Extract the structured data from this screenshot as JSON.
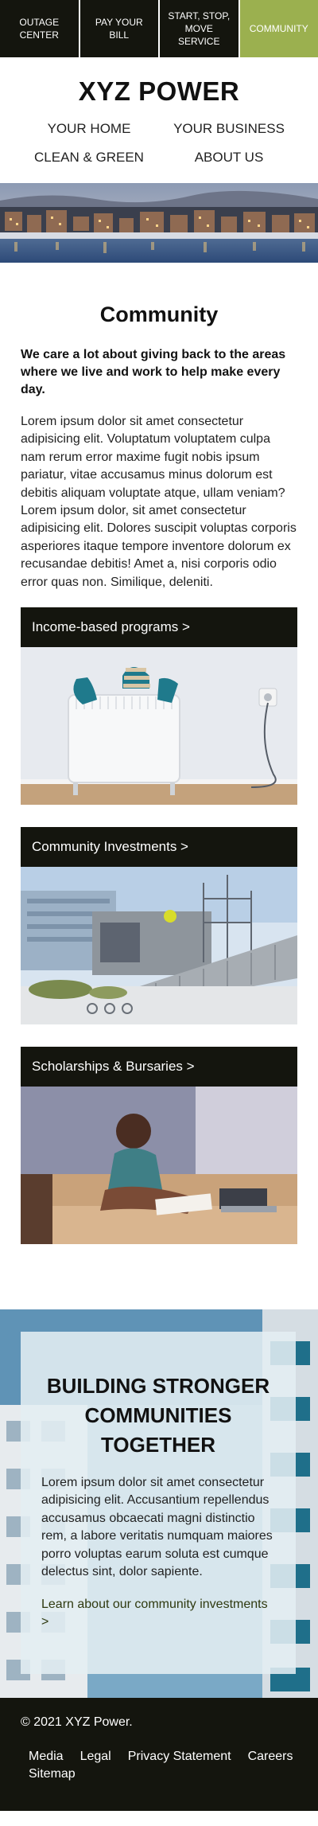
{
  "topnav": [
    {
      "label": "OUTAGE CENTER"
    },
    {
      "label": "PAY YOUR BILL"
    },
    {
      "label": "START, STOP, MOVE SERVICE"
    },
    {
      "label": "COMMUNITY"
    }
  ],
  "brand": {
    "name": "XYZ POWER"
  },
  "mainnav": [
    {
      "label": "YOUR HOME"
    },
    {
      "label": "YOUR BUSINESS"
    },
    {
      "label": "CLEAN & GREEN"
    },
    {
      "label": "ABOUT US"
    }
  ],
  "intro": {
    "title": "Community",
    "lead": "We care a lot about giving back to the areas where we live and work to help make every day.",
    "body": "Lorem ipsum dolor sit amet consectetur adipisicing elit. Voluptatum voluptatem culpa nam rerum error maxime fugit nobis ipsum pariatur, vitae accusamus minus dolorum est debitis aliquam voluptate atque, ullam veniam? Lorem ipsum dolor, sit amet consectetur adipisicing elit. Dolores suscipit voluptas corporis asperiores itaque tempore inventore dolorum ex recusandae debitis! Amet a, nisi corporis odio error quas non. Similique, deleniti."
  },
  "cards": [
    {
      "label": "Income-based programs >"
    },
    {
      "label": "Community Investments >"
    },
    {
      "label": "Scholarships & Bursaries >"
    }
  ],
  "building": {
    "title": "BUILDING STRONGER COMMUNITIES TOGETHER",
    "text": "Lorem ipsum dolor sit amet consectetur adipisicing elit. Accusantium repellendus accusamus obcaecati magni distinctio rem, a labore veritatis numquam maiores porro voluptas earum soluta est cumque delectus sint, dolor sapiente.",
    "link": "Learn about our community investments >"
  },
  "footer": {
    "copyright": "© 2021 XYZ Power.",
    "links": [
      {
        "label": "Media"
      },
      {
        "label": "Legal"
      },
      {
        "label": "Privacy Statement"
      },
      {
        "label": "Careers"
      },
      {
        "label": "Sitemap"
      }
    ]
  },
  "colors": {
    "dark": "#14150e",
    "accent": "#9bb04f",
    "panel": "#e4eef2"
  }
}
